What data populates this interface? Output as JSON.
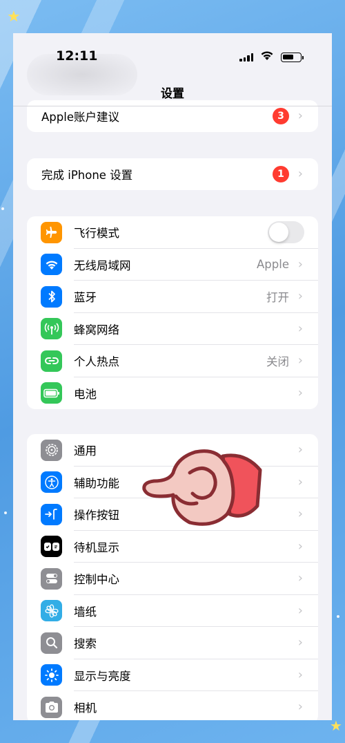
{
  "status_bar": {
    "time": "12:11"
  },
  "nav": {
    "title": "设置"
  },
  "colors": {
    "accent": "#007aff",
    "badge": "#ff3b30",
    "background": "#f2f2f7"
  },
  "account_group": [
    {
      "label": "Apple账户建议",
      "badge": "3"
    }
  ],
  "setup_group": [
    {
      "label": "完成 iPhone 设置",
      "badge": "1"
    }
  ],
  "connectivity_group": [
    {
      "label": "飞行模式",
      "icon": "airplane-icon",
      "color": "#ff9500",
      "toggle": "off"
    },
    {
      "label": "无线局域网",
      "icon": "wifi-icon",
      "color": "#007aff",
      "value": "Apple"
    },
    {
      "label": "蓝牙",
      "icon": "bluetooth-icon",
      "color": "#007aff",
      "value": "打开"
    },
    {
      "label": "蜂窝网络",
      "icon": "cellular-icon",
      "color": "#34c759",
      "value": ""
    },
    {
      "label": "个人热点",
      "icon": "hotspot-icon",
      "color": "#34c759",
      "value": "关闭"
    },
    {
      "label": "电池",
      "icon": "battery-icon",
      "color": "#34c759",
      "value": ""
    }
  ],
  "general_group": [
    {
      "label": "通用",
      "icon": "gear-icon",
      "color": "#8e8e93"
    },
    {
      "label": "辅助功能",
      "icon": "accessibility-icon",
      "color": "#007aff"
    },
    {
      "label": "操作按钮",
      "icon": "action-button-icon",
      "color": "#007aff"
    },
    {
      "label": "待机显示",
      "icon": "standby-icon",
      "color": "#000000"
    },
    {
      "label": "控制中心",
      "icon": "control-center-icon",
      "color": "#8e8e93"
    },
    {
      "label": "墙纸",
      "icon": "wallpaper-icon",
      "color": "#32ade6"
    },
    {
      "label": "搜索",
      "icon": "search-icon",
      "color": "#8e8e93"
    },
    {
      "label": "显示与亮度",
      "icon": "brightness-icon",
      "color": "#007aff"
    },
    {
      "label": "相机",
      "icon": "camera-icon",
      "color": "#8e8e93"
    }
  ]
}
